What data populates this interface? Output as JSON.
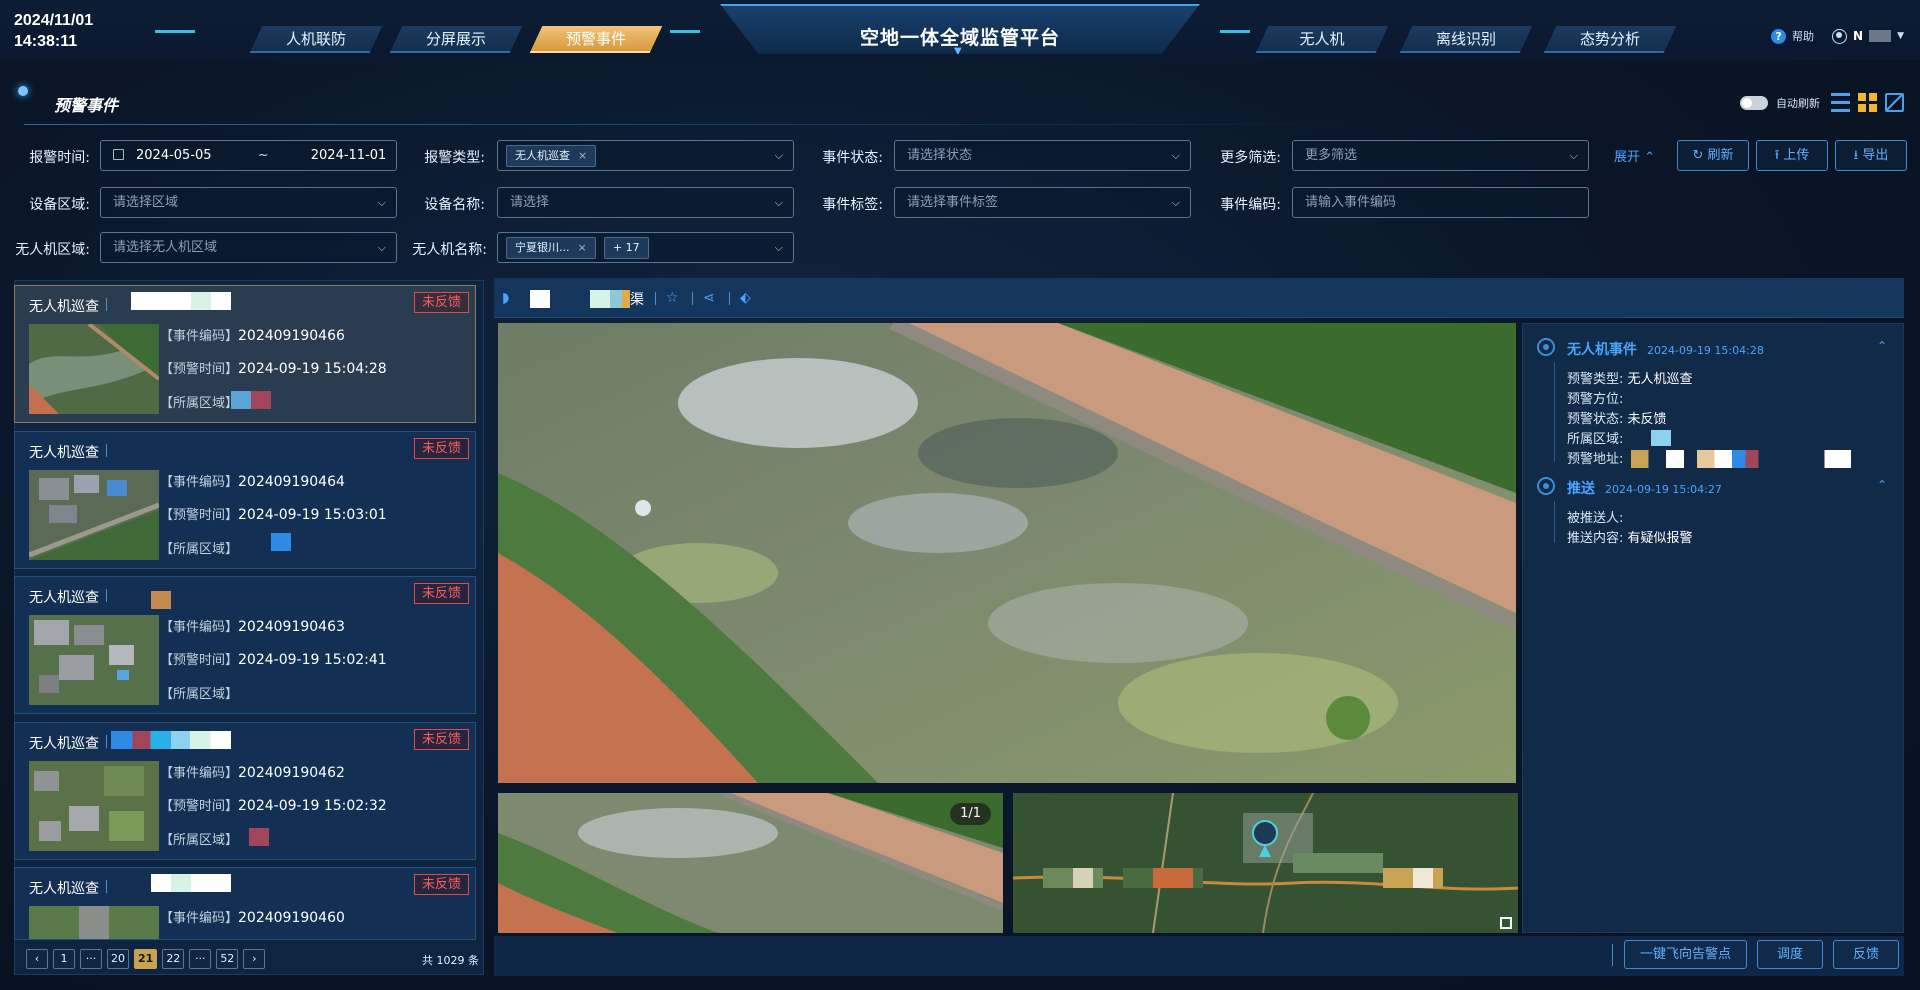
{
  "header": {
    "date": "2024/11/01",
    "time": "14:38:11",
    "title": "空地一体全域监管平台",
    "nav_left": [
      "人机联防",
      "分屏展示",
      "预警事件"
    ],
    "nav_right": [
      "无人机",
      "离线识别",
      "态势分析"
    ],
    "active_tab": "预警事件",
    "help": "帮助",
    "user": "N"
  },
  "page": {
    "title": "预警事件",
    "auto_refresh": "自动刷新",
    "view_icons": [
      "list-icon",
      "grid-icon",
      "map-icon"
    ]
  },
  "filters": {
    "alarm_time_label": "报警时间:",
    "date_start": "2024-05-05",
    "date_sep": "~",
    "date_end": "2024-11-01",
    "alarm_type_label": "报警类型:",
    "alarm_type_tag": "无人机巡查",
    "event_status_label": "事件状态:",
    "event_status_placeholder": "请选择状态",
    "more_filter_label": "更多筛选:",
    "more_filter_placeholder": "更多筛选",
    "device_area_label": "设备区域:",
    "device_area_placeholder": "请选择区域",
    "device_name_label": "设备名称:",
    "device_name_placeholder": "请选择",
    "event_tag_label": "事件标签:",
    "event_tag_placeholder": "请选择事件标签",
    "event_code_label": "事件编码:",
    "event_code_placeholder": "请输入事件编码",
    "drone_area_label": "无人机区域:",
    "drone_area_placeholder": "请选择无人机区域",
    "drone_name_label": "无人机名称:",
    "drone_name_tag": "宁夏银川...",
    "drone_name_more": "+ 17",
    "expand": "展开",
    "refresh": "刷新",
    "upload": "上传",
    "export": "导出"
  },
  "events": [
    {
      "type": "无人机巡查",
      "status": "未反馈",
      "code_label": "【事件编码】",
      "code": "202409190466",
      "time_label": "【预警时间】",
      "time": "2024-09-19 15:04:28",
      "area_label": "【所属区域】",
      "active": true
    },
    {
      "type": "无人机巡查",
      "status": "未反馈",
      "code_label": "【事件编码】",
      "code": "202409190464",
      "time_label": "【预警时间】",
      "time": "2024-09-19 15:03:01",
      "area_label": "【所属区域】"
    },
    {
      "type": "无人机巡查",
      "status": "未反馈",
      "code_label": "【事件编码】",
      "code": "202409190463",
      "time_label": "【预警时间】",
      "time": "2024-09-19 15:02:41",
      "area_label": "【所属区域】"
    },
    {
      "type": "无人机巡查",
      "status": "未反馈",
      "code_label": "【事件编码】",
      "code": "202409190462",
      "time_label": "【预警时间】",
      "time": "2024-09-19 15:02:32",
      "area_label": "【所属区域】"
    },
    {
      "type": "无人机巡查",
      "status": "未反馈",
      "code_label": "【事件编码】",
      "code": "202409190460"
    }
  ],
  "pagination": {
    "pages": [
      "1",
      "···",
      "20",
      "21",
      "22",
      "···",
      "52"
    ],
    "current": "21",
    "total": "共 1029 条"
  },
  "detail": {
    "bar_title_suffix": "渠",
    "image_counter": "1/1",
    "drone_event": {
      "title": "无人机事件",
      "time": "2024-09-19 15:04:28",
      "rows": [
        {
          "label": "预警类型:",
          "value": "无人机巡查"
        },
        {
          "label": "预警方位:",
          "value": ""
        },
        {
          "label": "预警状态:",
          "value": "未反馈"
        },
        {
          "label": "所属区域:",
          "value": ""
        },
        {
          "label": "预警地址:",
          "value": ""
        }
      ]
    },
    "push": {
      "title": "推送",
      "time": "2024-09-19 15:04:27",
      "rows": [
        {
          "label": "被推送人:",
          "value": ""
        },
        {
          "label": "推送内容:",
          "value": "有疑似报警"
        }
      ]
    },
    "actions": [
      "一键飞向告警点",
      "调度",
      "反馈"
    ]
  },
  "colors": {
    "accent": "#4aa3ff",
    "active_tab": "#e0a94a",
    "unhandled": "#ff5a5a",
    "page_current": "#c9a354"
  }
}
